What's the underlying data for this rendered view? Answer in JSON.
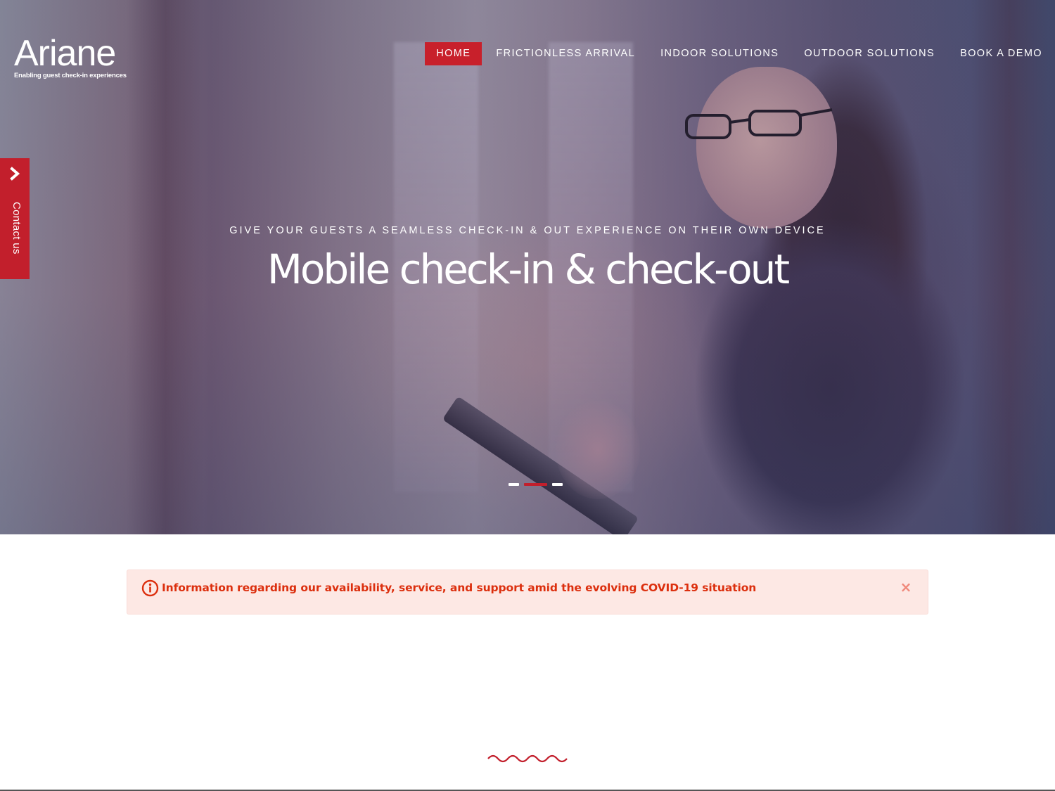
{
  "brand": {
    "logo_text": "Ariane",
    "tagline": "Enabling guest check-in experiences"
  },
  "nav": {
    "items": [
      {
        "label": "HOME",
        "active": true
      },
      {
        "label": "FRICTIONLESS ARRIVAL",
        "active": false
      },
      {
        "label": "INDOOR SOLUTIONS",
        "active": false
      },
      {
        "label": "OUTDOOR SOLUTIONS",
        "active": false
      },
      {
        "label": "BOOK A DEMO",
        "active": false
      }
    ]
  },
  "contact_tab": {
    "label": "Contact us",
    "icon": "chevron-right-icon"
  },
  "hero": {
    "subtitle": "GIVE YOUR GUESTS A SEAMLESS CHECK-IN & OUT EXPERIENCE ON THEIR OWN DEVICE",
    "title": "Mobile check-in & check-out",
    "slides_total": 3,
    "active_slide": 2
  },
  "alert": {
    "icon": "info-icon",
    "text": "Information regarding our availability, service, and support amid the evolving COVID-19 situation",
    "close_label": "×"
  },
  "colors": {
    "accent": "#c8202b",
    "alert_text": "#dc2f0e",
    "alert_bg": "#fde8e4",
    "wave": "#c21f2c"
  }
}
